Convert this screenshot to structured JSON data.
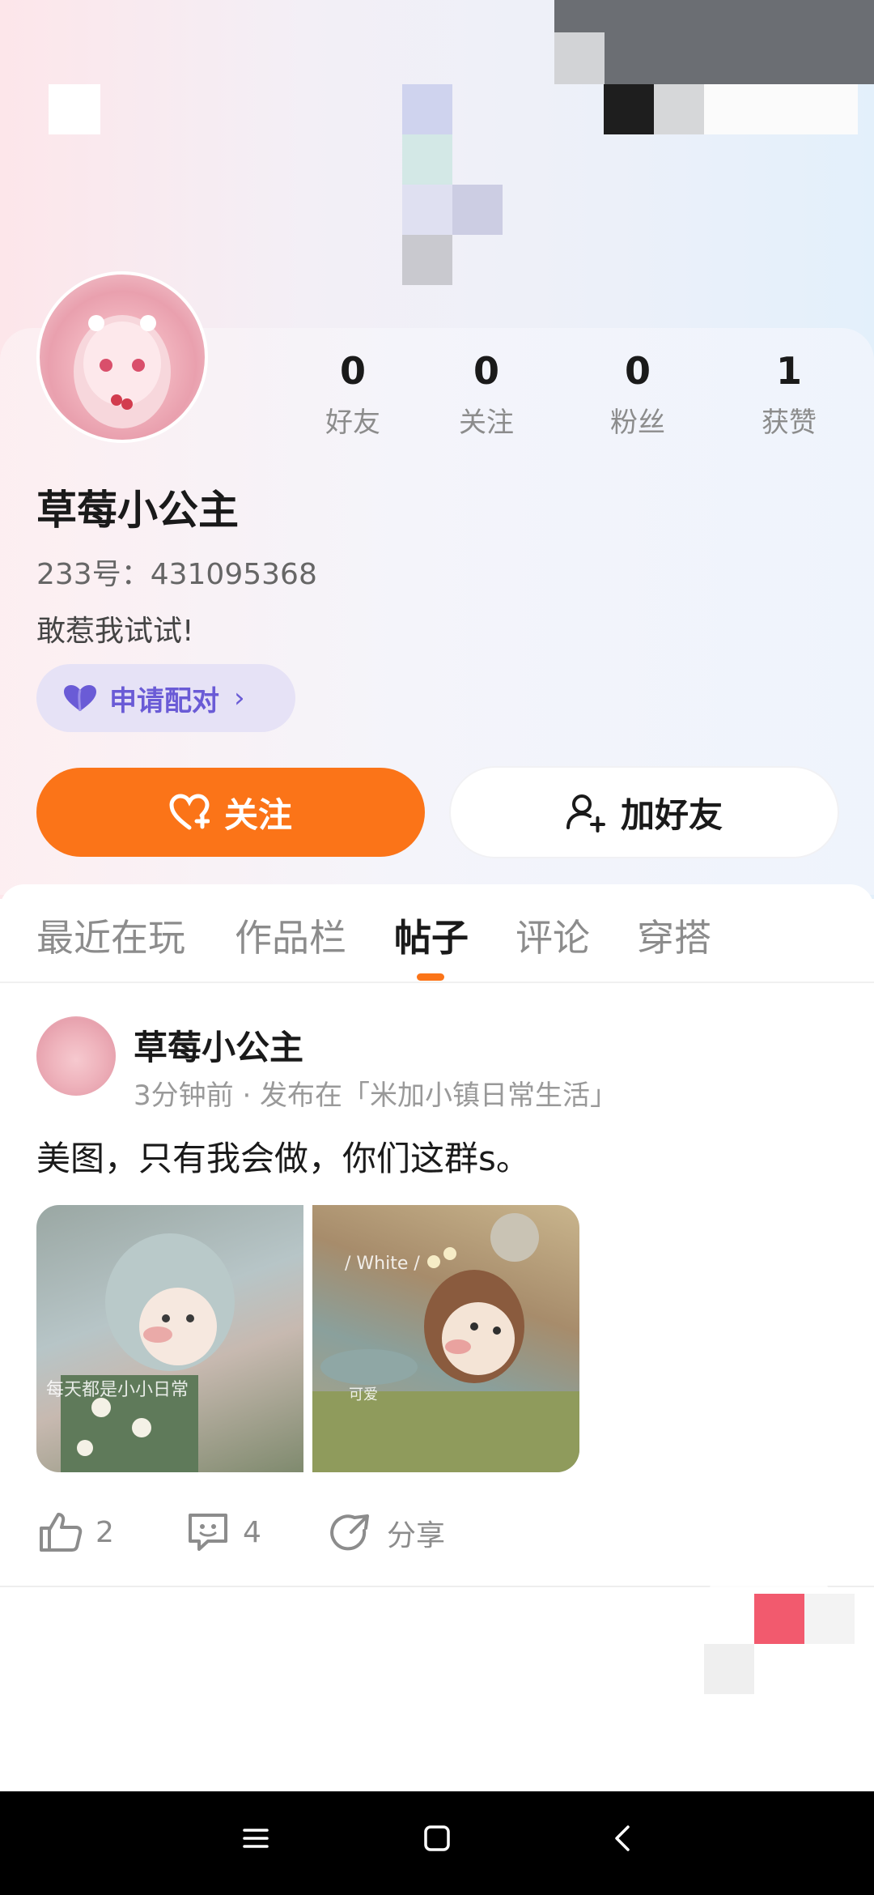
{
  "profile": {
    "username": "草莓小公主",
    "uid": "233号：431095368",
    "bio": "敢惹我试试!",
    "pair_button": "申请配对",
    "follow_button": "关注",
    "add_friend_button": "加好友"
  },
  "stats": [
    {
      "value": "0",
      "label": "好友"
    },
    {
      "value": "0",
      "label": "关注"
    },
    {
      "value": "0",
      "label": "粉丝"
    },
    {
      "value": "1",
      "label": "获赞"
    }
  ],
  "tabs": [
    "最近在玩",
    "作品栏",
    "帖子",
    "评论",
    "穿搭"
  ],
  "active_tab": "帖子",
  "post": {
    "author": "草莓小公主",
    "meta": "3分钟前 · 发布在「米加小镇日常生活」",
    "text": "美图，只有我会做，你们这群s。",
    "image1_caption": "每天都是小小日常",
    "image2_caption": "/ White /",
    "image2_tag": "可爱",
    "likes": "2",
    "comments": "4",
    "share_label": "分享"
  },
  "colors": {
    "accent": "#fb7418",
    "pair_purple": "#6a5bd6",
    "pair_bg": "#e6e2f6"
  },
  "icons": [
    "heart-plus-icon",
    "user-plus-icon",
    "heart-icon",
    "chevron-right-icon",
    "thumbs-up-icon",
    "comment-icon",
    "share-icon",
    "menu-icon",
    "home-square-icon",
    "back-icon"
  ]
}
